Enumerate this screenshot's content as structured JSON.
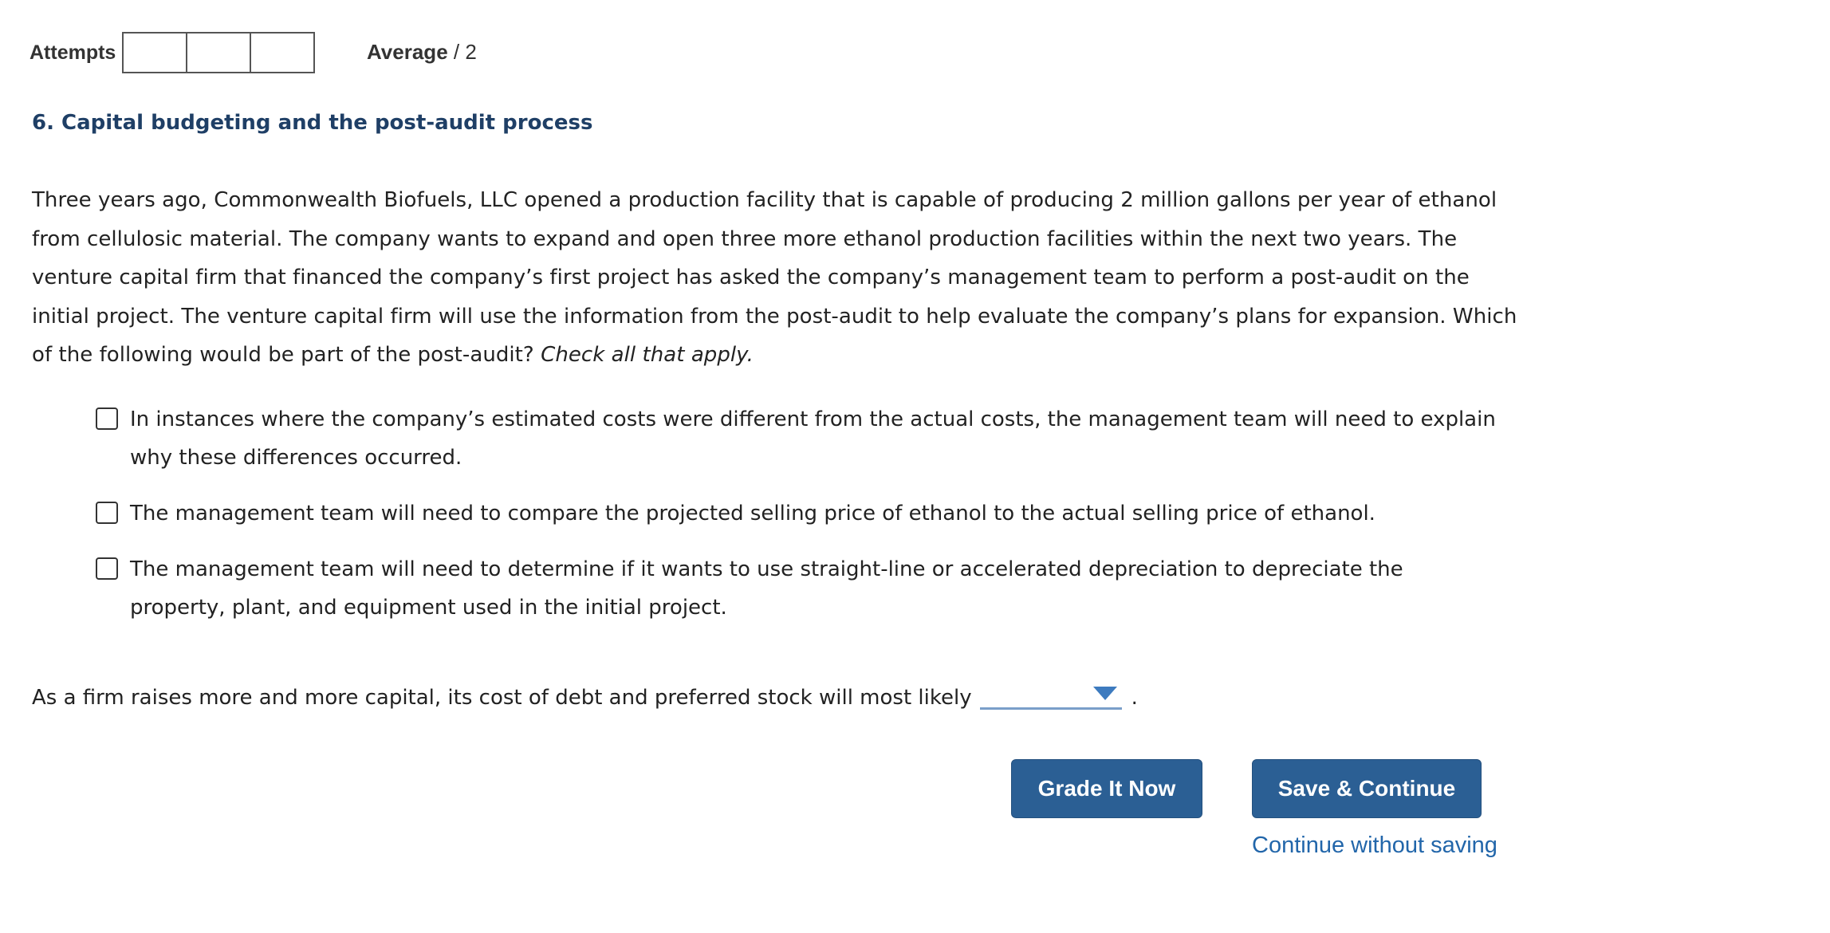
{
  "header": {
    "attempts_label": "Attempts",
    "attempt_boxes": [
      "",
      "",
      ""
    ],
    "average_label": "Average",
    "average_value": "/ 2"
  },
  "question": {
    "title": "6. Capital budgeting and the post-audit process",
    "body": "Three years ago, Commonwealth Biofuels, LLC opened a production facility that is capable of producing 2 million gallons per year of ethanol from cellulosic material. The company wants to expand and open three more ethanol production facilities within the next two years. The venture capital firm that financed the company’s first project has asked the company’s management team to perform a post-audit on the initial project. The venture capital firm will use the information from the post-audit to help evaluate the company’s plans for expansion. Which of the following would be part of the post-audit?",
    "instruction": "Check all that apply.",
    "options": [
      {
        "label": "In instances where the company’s estimated costs were different from the actual costs, the management team will need to explain why these differences occurred.",
        "checked": false
      },
      {
        "label": "The management team will need to compare the projected selling price of ethanol to the actual selling price of ethanol.",
        "checked": false
      },
      {
        "label": "The management team will need to determine if it wants to use straight-line or accelerated depreciation to depreciate the property, plant, and equipment used in the initial project.",
        "checked": false
      }
    ],
    "fill_in": {
      "sentence": "As a firm raises more and more capital, its cost of debt and preferred stock will most likely",
      "selected_value": "",
      "end_punctuation": "."
    }
  },
  "actions": {
    "grade_label": "Grade It Now",
    "save_label": "Save & Continue",
    "continue_link": "Continue without saving"
  },
  "colors": {
    "title": "#1f3f66",
    "button": "#2b5f94",
    "link": "#2266aa",
    "dropdown_arrow": "#3d7bbf"
  },
  "icons": {
    "dropdown": "triangle-down-icon"
  }
}
